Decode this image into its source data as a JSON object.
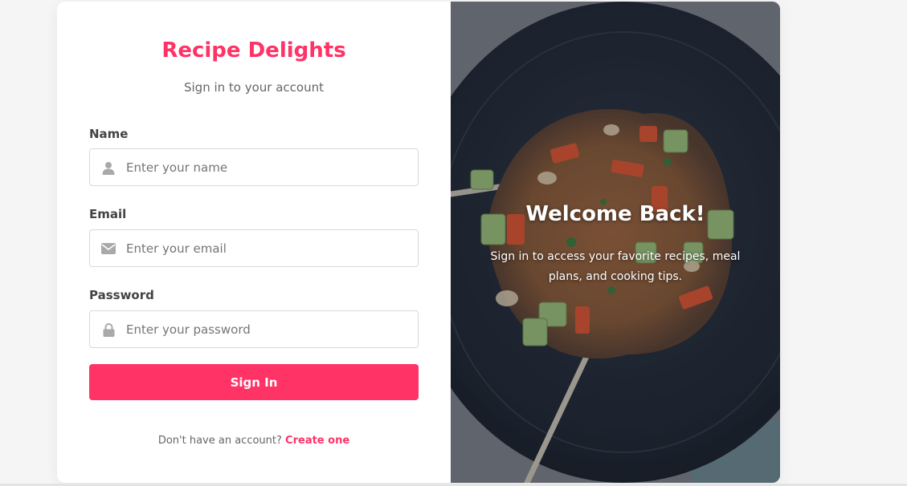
{
  "form": {
    "title": "Recipe Delights",
    "subtitle": "Sign in to your account",
    "fields": [
      {
        "label": "Name",
        "placeholder": "Enter your name",
        "icon": "user-icon"
      },
      {
        "label": "Email",
        "placeholder": "Enter your email",
        "icon": "envelope-icon"
      },
      {
        "label": "Password",
        "placeholder": "Enter your password",
        "icon": "lock-icon"
      }
    ],
    "submit_label": "Sign In",
    "signup_prompt": "Don't have an account?",
    "signup_link": "Create one"
  },
  "hero": {
    "title": "Welcome Back!",
    "text": "Sign in to access your favorite recipes, meal plans, and cooking tips."
  },
  "colors": {
    "accent": "#ff3366",
    "label": "#444444",
    "muted": "#666666",
    "input_border": "#d9d9d9",
    "page_background": "#f5f5f5"
  }
}
